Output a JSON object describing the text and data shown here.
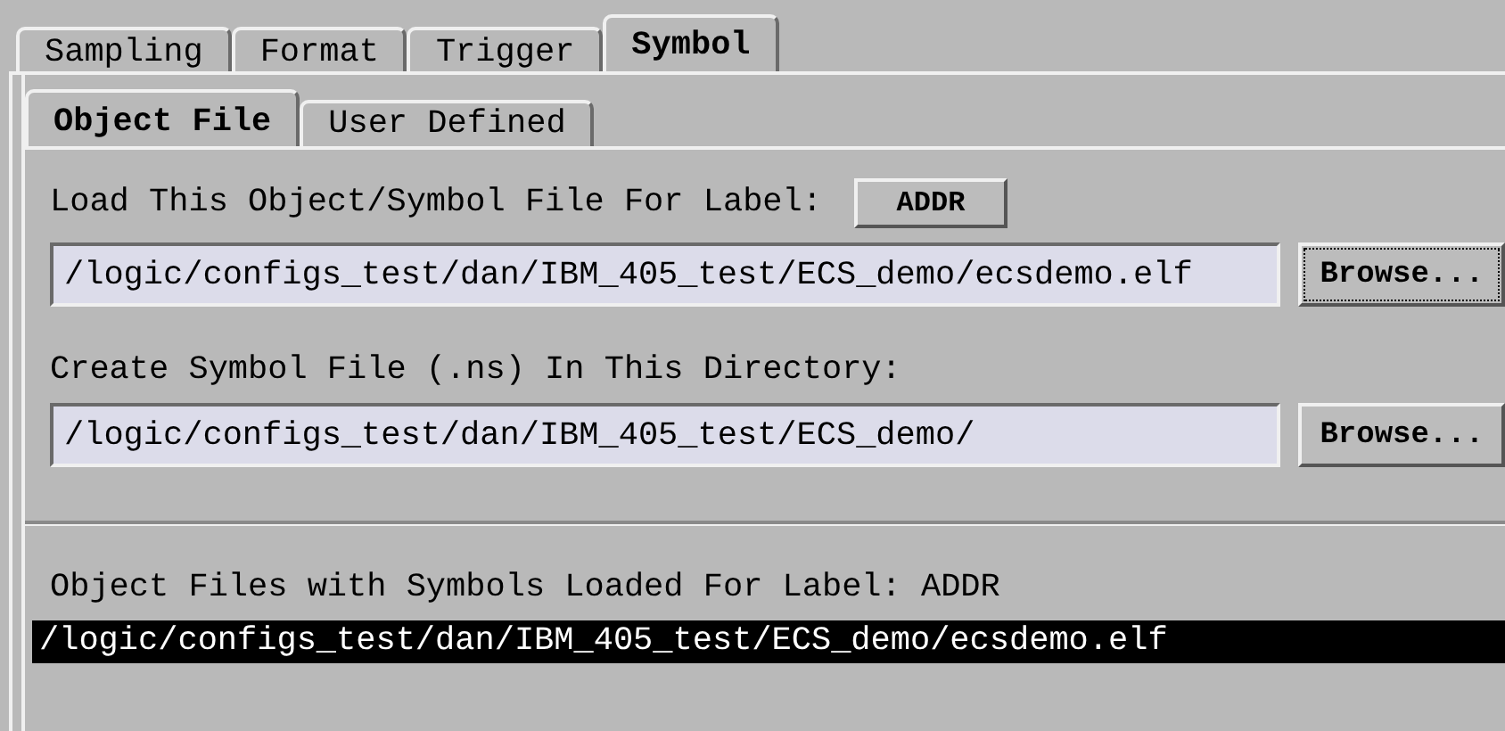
{
  "tabs": [
    {
      "label": "Sampling",
      "selected": false
    },
    {
      "label": "Format",
      "selected": false
    },
    {
      "label": "Trigger",
      "selected": false
    },
    {
      "label": "Symbol",
      "selected": true
    }
  ],
  "subtabs": [
    {
      "label": "Object File",
      "selected": true
    },
    {
      "label": "User Defined",
      "selected": false
    }
  ],
  "load": {
    "label": "Load This Object/Symbol File For Label:",
    "label_button": "ADDR",
    "path": "/logic/configs_test/dan/IBM_405_test/ECS_demo/ecsdemo.elf",
    "browse": "Browse...",
    "browse_focused": true
  },
  "create": {
    "label": "Create Symbol File (.ns) In This Directory:",
    "path": "/logic/configs_test/dan/IBM_405_test/ECS_demo/",
    "browse": "Browse...",
    "browse_focused": false
  },
  "loaded": {
    "label": "Object Files with Symbols Loaded For Label: ADDR",
    "items": [
      {
        "text": "/logic/configs_test/dan/IBM_405_test/ECS_demo/ecsdemo.elf",
        "selected": true
      }
    ]
  }
}
